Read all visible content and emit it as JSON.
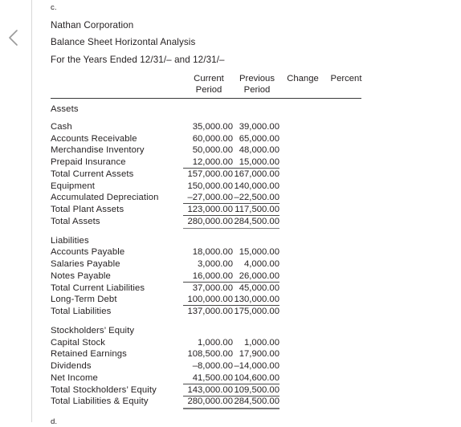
{
  "nav": {
    "prev_label": "previous",
    "chevron_icon": "chevron-left-icon"
  },
  "part_letter": "c.",
  "next_part_letter": "d.",
  "statement": {
    "company": "Nathan Corporation",
    "title": "Balance Sheet Horizontal Analysis",
    "period": "For the Years Ended 12/31/– and 12/31/–"
  },
  "columns": [
    {
      "line1": "Current",
      "line2": "Period"
    },
    {
      "line1": "Previous",
      "line2": "Period"
    },
    {
      "line1": "Change",
      "line2": ""
    },
    {
      "line1": "Percent",
      "line2": ""
    }
  ],
  "rows": [
    {
      "label": "Assets",
      "current": "",
      "previous": "",
      "change": "",
      "percent": "",
      "type": "section"
    },
    {
      "label": "Cash",
      "current": "35,000.00",
      "previous": "39,000.00",
      "change": "",
      "percent": "",
      "type": "item"
    },
    {
      "label": "Accounts Receivable",
      "current": "60,000.00",
      "previous": "65,000.00",
      "change": "",
      "percent": "",
      "type": "item"
    },
    {
      "label": "Merchandise Inventory",
      "current": "50,000.00",
      "previous": "48,000.00",
      "change": "",
      "percent": "",
      "type": "item"
    },
    {
      "label": "Prepaid Insurance",
      "current": "12,000.00",
      "previous": "15,000.00",
      "change": "",
      "percent": "",
      "type": "item-ruled"
    },
    {
      "label": "Total Current Assets",
      "current": "157,000.00",
      "previous": "167,000.00",
      "change": "",
      "percent": "",
      "type": "subtotal"
    },
    {
      "label": "Equipment",
      "current": "150,000.00",
      "previous": "140,000.00",
      "change": "",
      "percent": "",
      "type": "item"
    },
    {
      "label": "Accumulated Depreciation",
      "current": "–27,000.00",
      "previous": "–22,500.00",
      "change": "",
      "percent": "",
      "type": "item-ruled"
    },
    {
      "label": "Total Plant Assets",
      "current": "123,000.00",
      "previous": "117,500.00",
      "change": "",
      "percent": "",
      "type": "subtotal-ruled"
    },
    {
      "label": "Total Assets",
      "current": "280,000.00",
      "previous": "284,500.00",
      "change": "",
      "percent": "",
      "type": "grandtotal"
    },
    {
      "label": "Liabilities",
      "current": "",
      "previous": "",
      "change": "",
      "percent": "",
      "type": "section"
    },
    {
      "label": "Accounts Payable",
      "current": "18,000.00",
      "previous": "15,000.00",
      "change": "",
      "percent": "",
      "type": "item"
    },
    {
      "label": "Salaries Payable",
      "current": "3,000.00",
      "previous": "4,000.00",
      "change": "",
      "percent": "",
      "type": "item"
    },
    {
      "label": "Notes Payable",
      "current": "16,000.00",
      "previous": "26,000.00",
      "change": "",
      "percent": "",
      "type": "item-ruled"
    },
    {
      "label": "Total Current Liabilities",
      "current": "37,000.00",
      "previous": "45,000.00",
      "change": "",
      "percent": "",
      "type": "subtotal"
    },
    {
      "label": "Long-Term Debt",
      "current": "100,000.00",
      "previous": "130,000.00",
      "change": "",
      "percent": "",
      "type": "item-ruled"
    },
    {
      "label": "Total Liabilities",
      "current": "137,000.00",
      "previous": "175,000.00",
      "change": "",
      "percent": "",
      "type": "subtotal"
    },
    {
      "label": "Stockholders’ Equity",
      "current": "",
      "previous": "",
      "change": "",
      "percent": "",
      "type": "section"
    },
    {
      "label": "Capital Stock",
      "current": "1,000.00",
      "previous": "1,000.00",
      "change": "",
      "percent": "",
      "type": "item"
    },
    {
      "label": "Retained Earnings",
      "current": "108,500.00",
      "previous": "17,900.00",
      "change": "",
      "percent": "",
      "type": "item"
    },
    {
      "label": "Dividends",
      "current": "–8,000.00",
      "previous": "–14,000.00",
      "change": "",
      "percent": "",
      "type": "item"
    },
    {
      "label": "Net Income",
      "current": "41,500.00",
      "previous": "104,600.00",
      "change": "",
      "percent": "",
      "type": "item-ruled"
    },
    {
      "label": "Total Stockholders’ Equity",
      "current": "143,000.00",
      "previous": "109,500.00",
      "change": "",
      "percent": "",
      "type": "subtotal-ruled"
    },
    {
      "label": "Total Liabilities & Equity",
      "current": "280,000.00",
      "previous": "284,500.00",
      "change": "",
      "percent": "",
      "type": "grandtotal"
    }
  ]
}
